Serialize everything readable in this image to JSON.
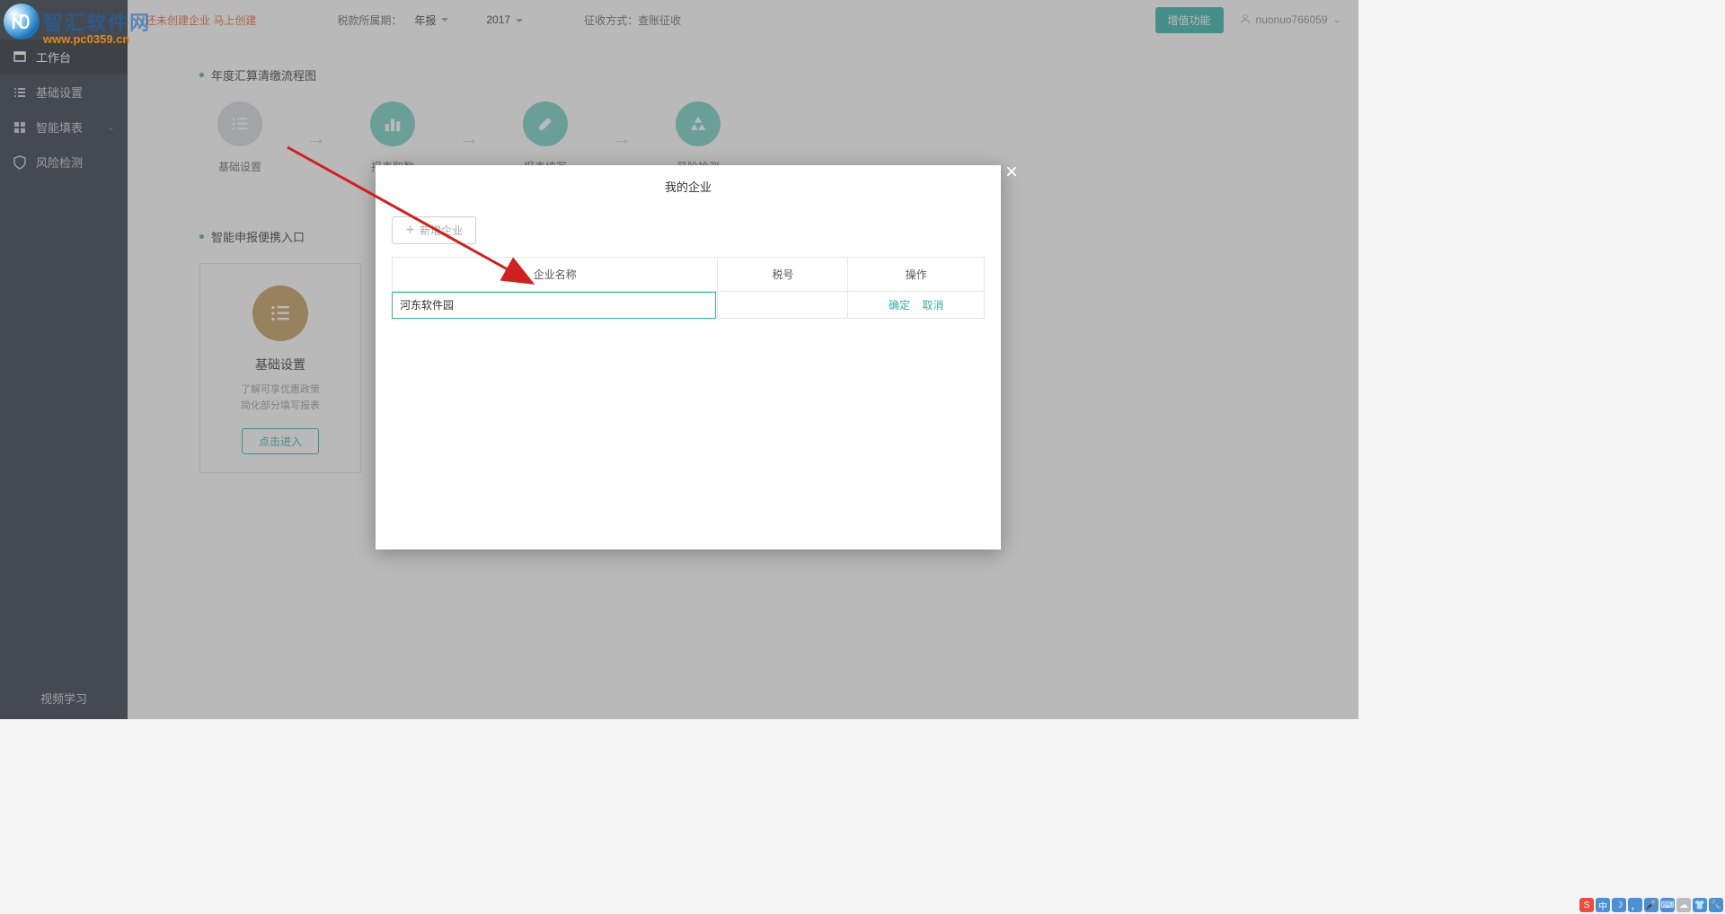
{
  "watermark": {
    "text": "智汇软件网",
    "url": "www.pc0359.cn"
  },
  "sidebar": {
    "items": [
      {
        "label": "工作台",
        "icon": "workbench"
      },
      {
        "label": "基础设置",
        "icon": "list"
      },
      {
        "label": "智能填表",
        "icon": "grid"
      },
      {
        "label": "风险检测",
        "icon": "shield"
      }
    ],
    "bottom": "视频学习"
  },
  "header": {
    "warning": "还未创建企业 马上创建",
    "period_label": "税款所属期：",
    "period_type": "年报",
    "year": "2017",
    "collection_label": "征收方式：",
    "collection_value": "查账征收",
    "vip_btn": "增值功能",
    "user": "nuonuo766059"
  },
  "main": {
    "flow_title": "年度汇算清缴流程图",
    "steps": [
      {
        "label": "基础设置",
        "color": "grey",
        "icon": "list"
      },
      {
        "label": "报表取数",
        "color": "teal",
        "icon": "bars"
      },
      {
        "label": "报表填写",
        "color": "teal",
        "icon": "pencil"
      },
      {
        "label": "风险检测",
        "color": "teal",
        "icon": "recycle"
      }
    ],
    "entry_title": "智能申报便携入口",
    "card": {
      "title": "基础设置",
      "desc1": "了解可享优惠政策",
      "desc2": "简化部分填写报表",
      "btn": "点击进入"
    }
  },
  "modal": {
    "title": "我的企业",
    "add_btn": "新增企业",
    "columns": {
      "name": "企业名称",
      "tax": "税号",
      "op": "操作"
    },
    "row": {
      "name_value": "河东软件园",
      "confirm": "确定",
      "cancel": "取消"
    }
  }
}
